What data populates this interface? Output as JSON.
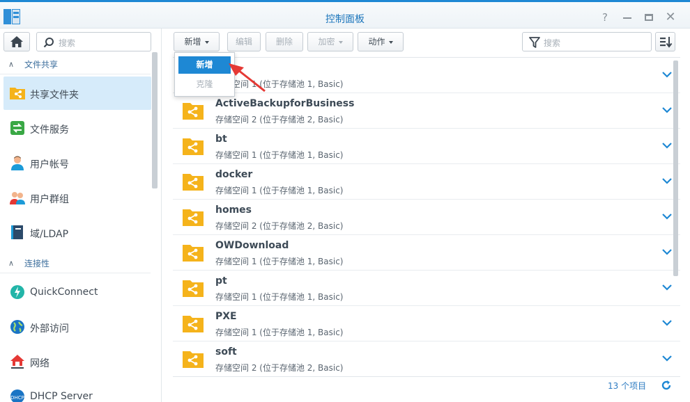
{
  "window": {
    "title": "控制面板"
  },
  "sidebar": {
    "search_placeholder": "搜索",
    "sections": [
      {
        "label": "文件共享"
      },
      {
        "label": "连接性"
      }
    ],
    "items": [
      {
        "label": "共享文件夹",
        "icon": "shared-folder-icon",
        "active": true
      },
      {
        "label": "文件服务",
        "icon": "file-services-icon"
      },
      {
        "label": "用户帐号",
        "icon": "user-icon"
      },
      {
        "label": "用户群组",
        "icon": "group-icon"
      },
      {
        "label": "域/LDAP",
        "icon": "domain-ldap-icon"
      },
      {
        "label": "QuickConnect",
        "icon": "quickconnect-icon"
      },
      {
        "label": "外部访问",
        "icon": "external-access-icon"
      },
      {
        "label": "网络",
        "icon": "network-icon"
      },
      {
        "label": "DHCP Server",
        "icon": "dhcp-server-icon"
      }
    ]
  },
  "toolbar": {
    "create_label": "新增",
    "edit_label": "编辑",
    "delete_label": "删除",
    "encrypt_label": "加密",
    "action_label": "动作",
    "search_placeholder": "搜索"
  },
  "dropdown": {
    "items": [
      {
        "label": "新增",
        "selected": true
      },
      {
        "label": "克隆",
        "enabled": false
      }
    ]
  },
  "folders": [
    {
      "name": "",
      "location": "存储空间 1 (位于存储池 1, Basic)"
    },
    {
      "name": "ActiveBackupforBusiness",
      "location": "存储空间 2 (位于存储池 2, Basic)"
    },
    {
      "name": "bt",
      "location": "存储空间 1 (位于存储池 1, Basic)"
    },
    {
      "name": "docker",
      "location": "存储空间 1 (位于存储池 1, Basic)"
    },
    {
      "name": "homes",
      "location": "存储空间 2 (位于存储池 2, Basic)"
    },
    {
      "name": "OWDownload",
      "location": "存储空间 1 (位于存储池 1, Basic)"
    },
    {
      "name": "pt",
      "location": "存储空间 1 (位于存储池 1, Basic)"
    },
    {
      "name": "PXE",
      "location": "存储空间 1 (位于存储池 1, Basic)"
    },
    {
      "name": "soft",
      "location": "存储空间 2 (位于存储池 2, Basic)"
    }
  ],
  "footer": {
    "item_count": "13 个项目"
  },
  "colors": {
    "accent": "#1e88d4",
    "folder": "#f5b31b",
    "annotation_arrow": "#e53935"
  }
}
